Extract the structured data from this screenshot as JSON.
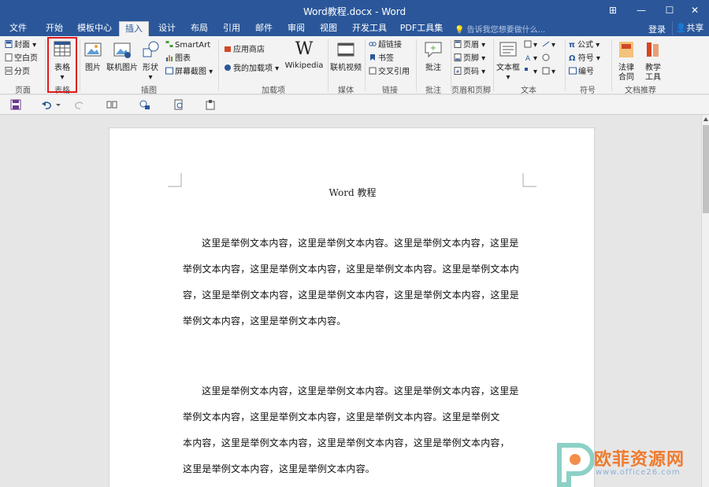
{
  "window": {
    "title": "Word教程.docx - Word",
    "controls": [
      "⊞",
      "—",
      "☐",
      "✕"
    ]
  },
  "tabs": [
    "文件",
    "开始",
    "模板中心",
    "插入",
    "设计",
    "布局",
    "引用",
    "邮件",
    "审阅",
    "视图",
    "开发工具",
    "PDF工具集"
  ],
  "active_tab": "插入",
  "tell_me": "告诉我您想要做什么...",
  "signin": "登录",
  "share": "共享",
  "ribbon": {
    "pages": {
      "cover": "封面",
      "blank": "空白页",
      "break": "分页",
      "label": "页面"
    },
    "table": {
      "button": "表格",
      "label": "表格"
    },
    "illustrations": {
      "picture": "图片",
      "online_picture": "联机图片",
      "shapes": "形状",
      "smartart": "SmartArt",
      "chart": "图表",
      "screenshot": "屏幕截图",
      "label": "插图"
    },
    "addins": {
      "store": "应用商店",
      "my_addins": "我的加载项",
      "wikipedia": "Wikipedia",
      "label": "加载项"
    },
    "media": {
      "online_video": "联机视频",
      "label": "媒体"
    },
    "links": {
      "hyperlink": "超链接",
      "bookmark": "书签",
      "cross_ref": "交叉引用",
      "label": "链接"
    },
    "comments": {
      "comment": "批注",
      "label": "批注"
    },
    "header_footer": {
      "header": "页眉",
      "footer": "页脚",
      "page_number": "页码",
      "label": "页眉和页脚"
    },
    "text": {
      "textbox": "文本框",
      "label": "文本"
    },
    "symbols": {
      "equation": "公式",
      "symbol": "符号",
      "number": "编号",
      "label": "符号"
    },
    "recommend": {
      "law": "法律合同",
      "teaching": "教学工具",
      "label": "文档推荐"
    }
  },
  "document": {
    "title": "Word 教程",
    "para1": [
      "这里是举例文本内容，这里是举例文本内容。这里是举例文本内容，这里是",
      "举例文本内容，这里是举例文本内容，这里是举例文本内容。这里是举例文本内",
      "容，这里是举例文本内容，这里是举例文本内容，这里是举例文本内容，这里是",
      "举例文本内容，这里是举例文本内容。"
    ],
    "para2": [
      "这里是举例文本内容，这里是举例文本内容。这里是举例文本内容，这里是",
      "举例文本内容，这里是举例文本内容，这里是举例文本内容。这里是举例文",
      "本内容，这里是举例文本内容，这里是举例文本内容，这里是举例文本内容，",
      "这里是举例文本内容，这里是举例文本内容。"
    ]
  },
  "watermark": {
    "name": "欧菲资源网",
    "url": "www.office26.com"
  },
  "colors": {
    "accent": "#2b579a",
    "highlight": "#e01a1a"
  }
}
